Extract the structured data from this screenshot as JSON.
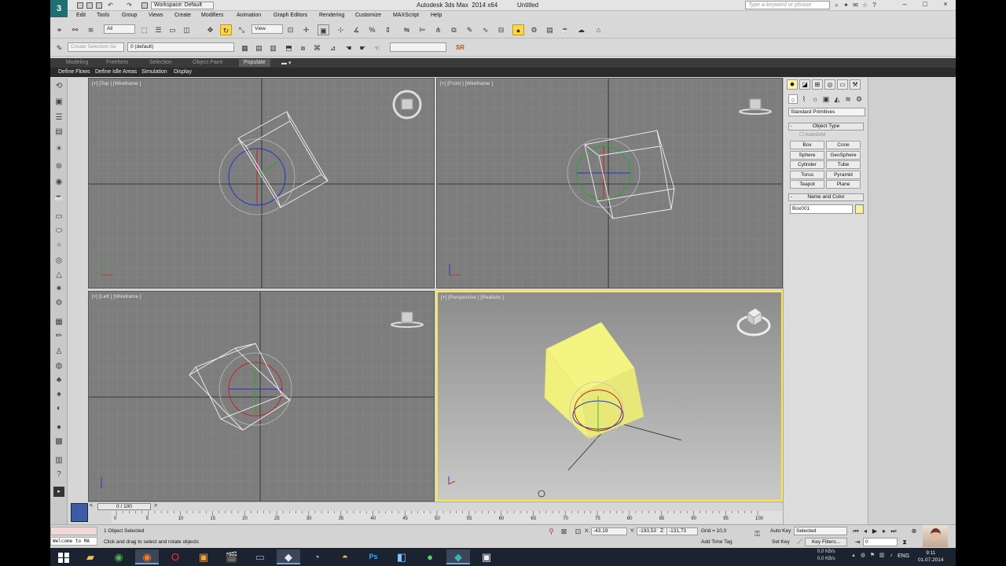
{
  "titlebar": {
    "workspace": "Workspace: Default",
    "app_title": "Autodesk 3ds Max  2014 x64",
    "doc_title": "Untitled",
    "search_placeholder": "Type a keyword or phrase"
  },
  "menus": [
    "Edit",
    "Tools",
    "Group",
    "Views",
    "Create",
    "Modifiers",
    "Animation",
    "Graph Editors",
    "Rendering",
    "Customize",
    "MAXScript",
    "Help"
  ],
  "toolbar1": {
    "filter": "All",
    "ref_coord": "View",
    "selection_set_placeholder": "Create Selection Se",
    "layer": "0 (default)"
  },
  "ribbon": {
    "tabs": [
      "Modeling",
      "Freeform",
      "Selection",
      "Object Paint",
      "Populate"
    ],
    "active_tab": "Populate",
    "buttons": [
      "Define Flows",
      "Define Idle Areas",
      "Simulation",
      "Display"
    ]
  },
  "viewports": {
    "top": "[+] [Top ] [Wireframe ]",
    "front": "[+] [Front ] [Wireframe ]",
    "left": "[+] [Left ] [Wireframe ]",
    "perspective": "[+] [Perspective ] [Realistic ]",
    "viewcube_top": "TOP"
  },
  "command_panel": {
    "category": "Standard Primitives",
    "object_type_title": "Object Type",
    "autogrid": "AutoGrid",
    "buttons": [
      "Box",
      "Cone",
      "Sphere",
      "GeoSphere",
      "Cylinder",
      "Tube",
      "Torus",
      "Pyramid",
      "Teapot",
      "Plane"
    ],
    "name_color_title": "Name and Color",
    "object_name": "Box001",
    "object_color": "#f4f49a"
  },
  "timeline": {
    "frame_indicator": "0 / 100",
    "ticks": [
      "0",
      "5",
      "10",
      "15",
      "20",
      "25",
      "30",
      "35",
      "40",
      "45",
      "50",
      "55",
      "60",
      "65",
      "70",
      "75",
      "80",
      "85",
      "90",
      "95",
      "100"
    ]
  },
  "status": {
    "maxscript_welcome": "Welcome to MA",
    "selection": "1 Object Selected",
    "prompt": "Click and drag to select and rotate objects",
    "x": "-43,19",
    "y": "-193,53",
    "z": "-131,73",
    "grid": "Grid = 10,0",
    "add_time_tag": "Add Time Tag",
    "auto_key": "Auto Key",
    "set_key": "Set Key",
    "key_mode": "Selected",
    "key_filters": "Key Filters...",
    "current_frame": "0"
  },
  "taskbar": {
    "net_up": "0,0 KB/s",
    "net_down": "0,0 KB/s",
    "lang": "ENG",
    "time": "9:11",
    "date": "01.07.2014"
  }
}
